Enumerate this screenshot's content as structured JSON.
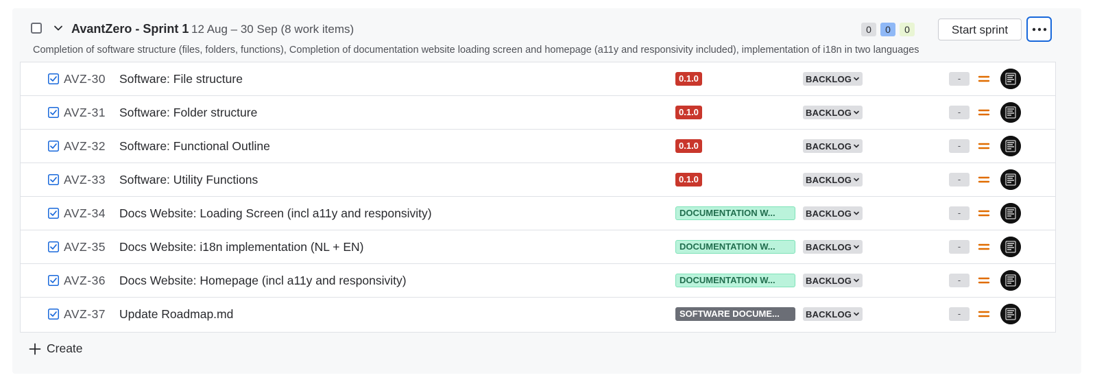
{
  "sprint": {
    "name": "AvantZero - Sprint 1",
    "dates": "12 Aug – 30 Sep (8 work items)",
    "goal": "Completion of software structure (files, folders, functions), Completion of documentation website loading screen and homepage (a11y and responsivity included), implementation of i18n in two languages",
    "counts": {
      "todo": "0",
      "in_progress": "0",
      "done": "0"
    },
    "start_label": "Start sprint",
    "colors": {
      "accent": "#1868db",
      "todo": "#dddee1",
      "in_progress": "#8fb8f6",
      "done": "#e9f5d4"
    }
  },
  "items": [
    {
      "key": "AVZ-30",
      "summary": "Software: File structure",
      "tag": "0.1.0",
      "tag_style": "red",
      "status": "BACKLOG",
      "points": "-",
      "priority_icon": "priority-medium-icon"
    },
    {
      "key": "AVZ-31",
      "summary": "Software: Folder structure",
      "tag": "0.1.0",
      "tag_style": "red",
      "status": "BACKLOG",
      "points": "-",
      "priority_icon": "priority-medium-icon"
    },
    {
      "key": "AVZ-32",
      "summary": "Software: Functional Outline",
      "tag": "0.1.0",
      "tag_style": "red",
      "status": "BACKLOG",
      "points": "-",
      "priority_icon": "priority-medium-icon"
    },
    {
      "key": "AVZ-33",
      "summary": "Software: Utility Functions",
      "tag": "0.1.0",
      "tag_style": "red",
      "status": "BACKLOG",
      "points": "-",
      "priority_icon": "priority-medium-icon"
    },
    {
      "key": "AVZ-34",
      "summary": "Docs Website: Loading Screen (incl a11y and responsivity)",
      "tag": "DOCUMENTATION W...",
      "tag_style": "green",
      "status": "BACKLOG",
      "points": "-",
      "priority_icon": "priority-medium-icon"
    },
    {
      "key": "AVZ-35",
      "summary": "Docs Website: i18n implementation (NL + EN)",
      "tag": "DOCUMENTATION W...",
      "tag_style": "green",
      "status": "BACKLOG",
      "points": "-",
      "priority_icon": "priority-medium-icon"
    },
    {
      "key": "AVZ-36",
      "summary": "Docs Website: Homepage (incl a11y and responsivity)",
      "tag": "DOCUMENTATION W...",
      "tag_style": "green",
      "status": "BACKLOG",
      "points": "-",
      "priority_icon": "priority-medium-icon"
    },
    {
      "key": "AVZ-37",
      "summary": "Update Roadmap.md",
      "tag": "SOFTWARE DOCUME...",
      "tag_style": "gray",
      "status": "BACKLOG",
      "points": "-",
      "priority_icon": "priority-medium-icon"
    }
  ],
  "create_label": "Create"
}
